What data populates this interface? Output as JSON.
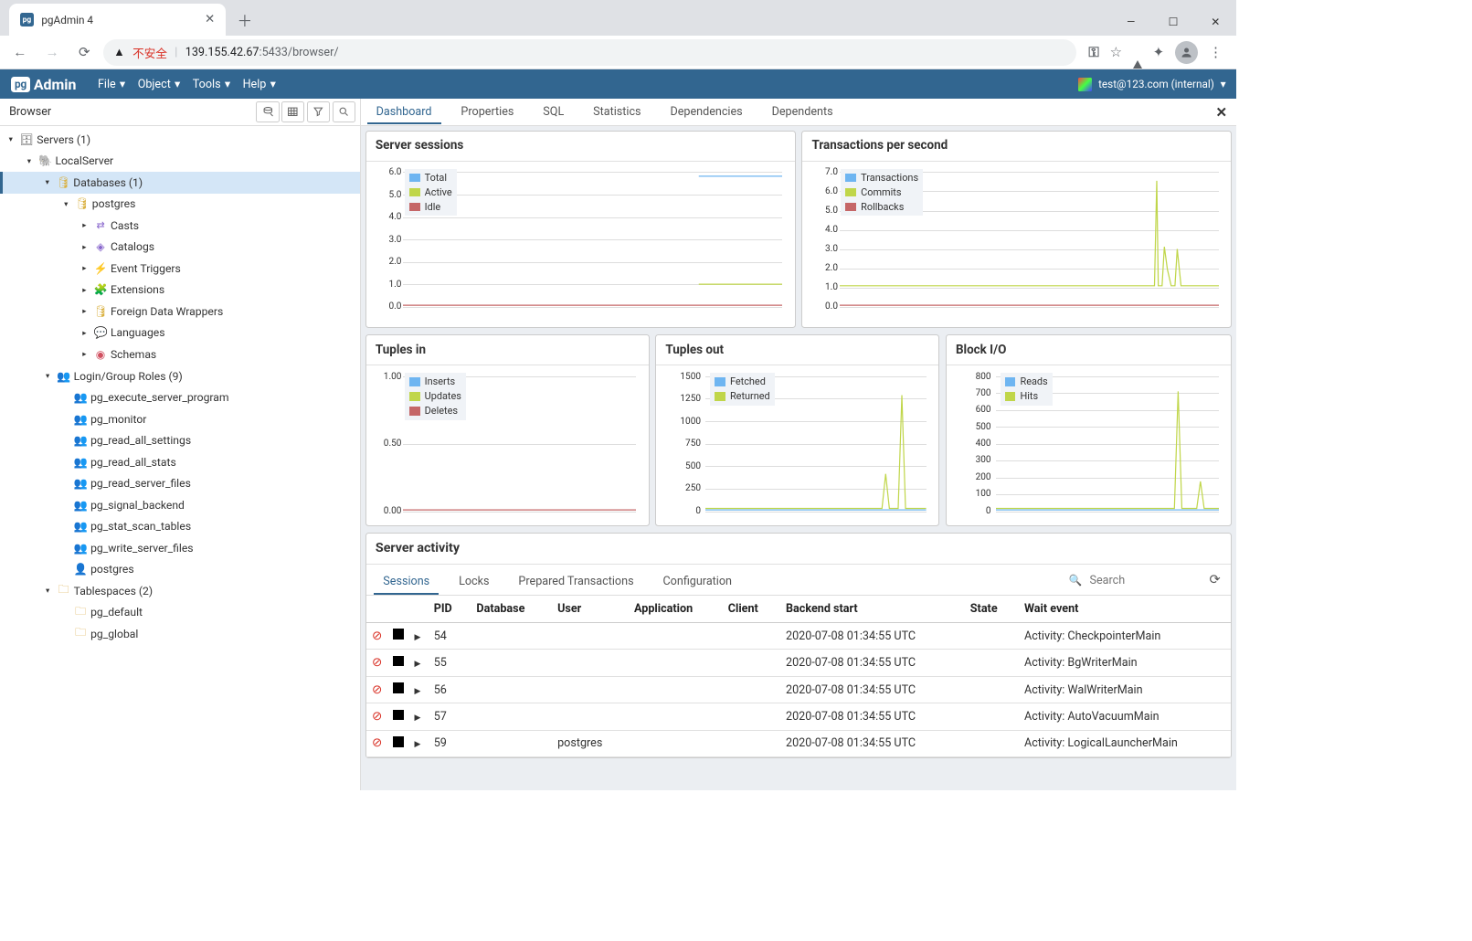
{
  "browser_chrome": {
    "tab_title": "pgAdmin 4",
    "url_text_insecure": "不安全",
    "url_host": "139.155.42.67",
    "url_port_path": ":5433/browser/"
  },
  "pgadmin_header": {
    "brand_prefix": "pg",
    "brand_name": "Admin",
    "menu": {
      "file": "File",
      "object": "Object",
      "tools": "Tools",
      "help": "Help"
    },
    "user": "test@123.com (internal)"
  },
  "sidebar": {
    "title": "Browser",
    "tree": {
      "servers": "Servers (1)",
      "local_server": "LocalServer",
      "databases": "Databases (1)",
      "postgres_db": "postgres",
      "db_children": {
        "casts": "Casts",
        "catalogs": "Catalogs",
        "event_triggers": "Event Triggers",
        "extensions": "Extensions",
        "fdw": "Foreign Data Wrappers",
        "languages": "Languages",
        "schemas": "Schemas"
      },
      "login_roles": "Login/Group Roles (9)",
      "roles": [
        "pg_execute_server_program",
        "pg_monitor",
        "pg_read_all_settings",
        "pg_read_all_stats",
        "pg_read_server_files",
        "pg_signal_backend",
        "pg_stat_scan_tables",
        "pg_write_server_files",
        "postgres"
      ],
      "tablespaces": "Tablespaces (2)",
      "tablespace_items": {
        "pg_default": "pg_default",
        "pg_global": "pg_global"
      }
    }
  },
  "tabs": {
    "dashboard": "Dashboard",
    "properties": "Properties",
    "sql": "SQL",
    "statistics": "Statistics",
    "dependencies": "Dependencies",
    "dependents": "Dependents"
  },
  "dashboard": {
    "sessions_title": "Server sessions",
    "tps_title": "Transactions per second",
    "tuples_in_title": "Tuples in",
    "tuples_out_title": "Tuples out",
    "block_io_title": "Block I/O",
    "legends": {
      "sessions": {
        "total": "Total",
        "active": "Active",
        "idle": "Idle"
      },
      "tps": {
        "transactions": "Transactions",
        "commits": "Commits",
        "rollbacks": "Rollbacks"
      },
      "tuples_in": {
        "inserts": "Inserts",
        "updates": "Updates",
        "deletes": "Deletes"
      },
      "tuples_out": {
        "fetched": "Fetched",
        "returned": "Returned"
      },
      "block_io": {
        "reads": "Reads",
        "hits": "Hits"
      }
    },
    "yticks": {
      "sessions": [
        "6.0",
        "5.0",
        "4.0",
        "3.0",
        "2.0",
        "1.0",
        "0.0"
      ],
      "tps": [
        "7.0",
        "6.0",
        "5.0",
        "4.0",
        "3.0",
        "2.0",
        "1.0",
        "0.0"
      ],
      "tuples_in": [
        "1.00",
        "0.50",
        "0.00"
      ],
      "tuples_out": [
        "1500",
        "1250",
        "1000",
        "750",
        "500",
        "250",
        "0"
      ],
      "block_io": [
        "800",
        "700",
        "600",
        "500",
        "400",
        "300",
        "200",
        "100",
        "0"
      ]
    }
  },
  "activity": {
    "title": "Server activity",
    "tabs": {
      "sessions": "Sessions",
      "locks": "Locks",
      "prepared": "Prepared Transactions",
      "configuration": "Configuration"
    },
    "search_placeholder": "Search",
    "columns": {
      "pid": "PID",
      "database": "Database",
      "user": "User",
      "application": "Application",
      "client": "Client",
      "backend_start": "Backend start",
      "state": "State",
      "wait_event": "Wait event"
    },
    "rows": [
      {
        "pid": "54",
        "database": "",
        "user": "",
        "application": "",
        "client": "",
        "backend_start": "2020-07-08 01:34:55 UTC",
        "state": "",
        "wait_event": "Activity: CheckpointerMain"
      },
      {
        "pid": "55",
        "database": "",
        "user": "",
        "application": "",
        "client": "",
        "backend_start": "2020-07-08 01:34:55 UTC",
        "state": "",
        "wait_event": "Activity: BgWriterMain"
      },
      {
        "pid": "56",
        "database": "",
        "user": "",
        "application": "",
        "client": "",
        "backend_start": "2020-07-08 01:34:55 UTC",
        "state": "",
        "wait_event": "Activity: WalWriterMain"
      },
      {
        "pid": "57",
        "database": "",
        "user": "",
        "application": "",
        "client": "",
        "backend_start": "2020-07-08 01:34:55 UTC",
        "state": "",
        "wait_event": "Activity: AutoVacuumMain"
      },
      {
        "pid": "59",
        "database": "",
        "user": "postgres",
        "application": "",
        "client": "",
        "backend_start": "2020-07-08 01:34:55 UTC",
        "state": "",
        "wait_event": "Activity: LogicalLauncherMain"
      }
    ]
  },
  "chart_data": [
    {
      "type": "line",
      "title": "Server sessions",
      "ylim": [
        0,
        6
      ],
      "series": [
        {
          "name": "Total",
          "values_last": 6,
          "color": "#6eb5f1"
        },
        {
          "name": "Active",
          "values_last": 1,
          "color": "#c0d64a"
        },
        {
          "name": "Idle",
          "values_last": 0,
          "color": "#c56667"
        }
      ]
    },
    {
      "type": "line",
      "title": "Transactions per second",
      "ylim": [
        0,
        7
      ],
      "series": [
        {
          "name": "Transactions",
          "color": "#6eb5f1"
        },
        {
          "name": "Commits",
          "color": "#c0d64a",
          "spikes": [
            6.5,
            3,
            2,
            3
          ]
        },
        {
          "name": "Rollbacks",
          "color": "#c56667"
        }
      ]
    },
    {
      "type": "line",
      "title": "Tuples in",
      "ylim": [
        0,
        1
      ],
      "series": [
        {
          "name": "Inserts",
          "color": "#6eb5f1"
        },
        {
          "name": "Updates",
          "color": "#c0d64a"
        },
        {
          "name": "Deletes",
          "color": "#c56667",
          "values_last": 0
        }
      ]
    },
    {
      "type": "line",
      "title": "Tuples out",
      "ylim": [
        0,
        1500
      ],
      "series": [
        {
          "name": "Fetched",
          "color": "#6eb5f1"
        },
        {
          "name": "Returned",
          "color": "#c0d64a",
          "spikes": [
            400,
            1300
          ]
        }
      ]
    },
    {
      "type": "line",
      "title": "Block I/O",
      "ylim": [
        0,
        800
      ],
      "series": [
        {
          "name": "Reads",
          "color": "#6eb5f1"
        },
        {
          "name": "Hits",
          "color": "#c0d64a",
          "spikes": [
            720,
            180
          ]
        }
      ]
    }
  ]
}
